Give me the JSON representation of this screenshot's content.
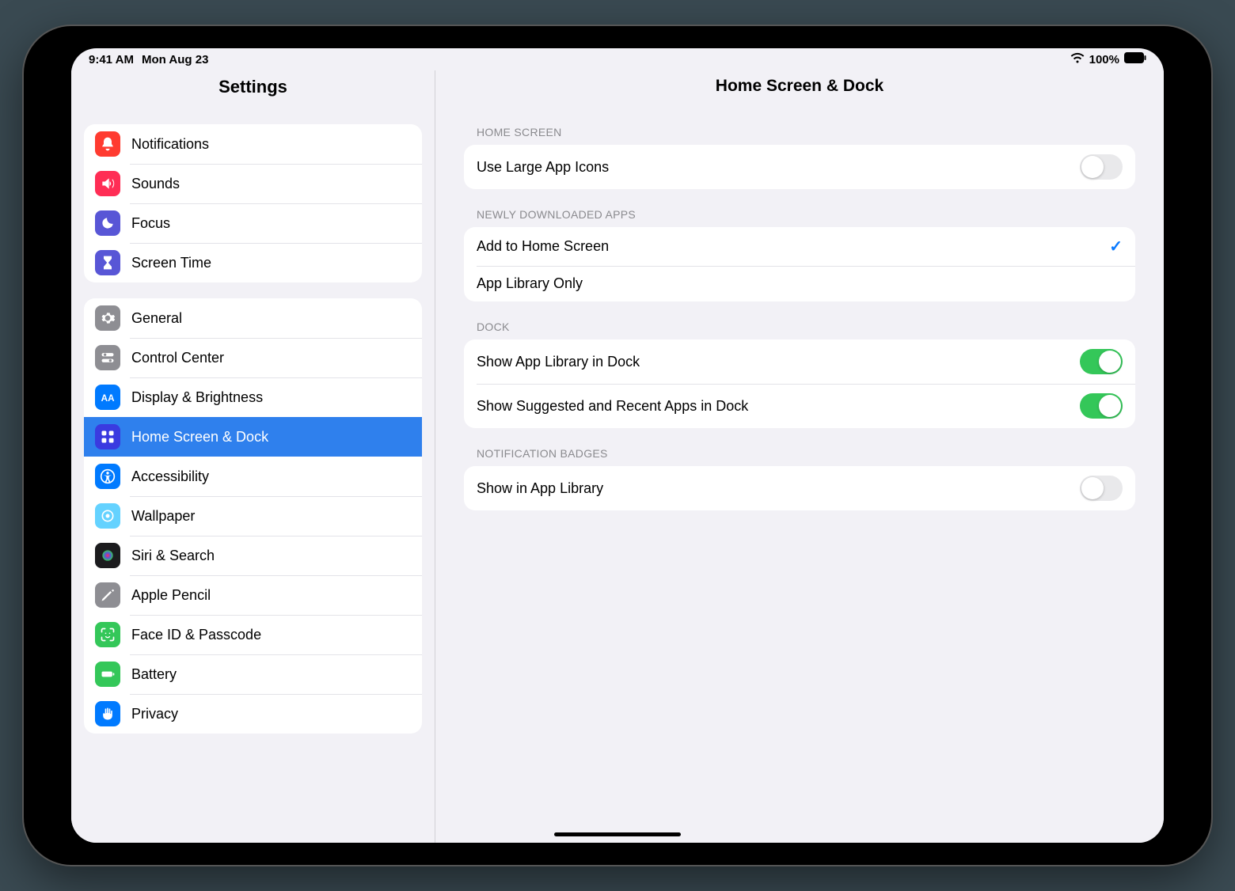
{
  "status": {
    "time": "9:41 AM",
    "date": "Mon Aug 23",
    "battery_pct": "100%"
  },
  "sidebar": {
    "title": "Settings",
    "group1": [
      {
        "label": "Notifications",
        "icon": "bell-icon"
      },
      {
        "label": "Sounds",
        "icon": "speaker-icon"
      },
      {
        "label": "Focus",
        "icon": "moon-icon"
      },
      {
        "label": "Screen Time",
        "icon": "hourglass-icon"
      }
    ],
    "group2": [
      {
        "label": "General",
        "icon": "gear-icon"
      },
      {
        "label": "Control Center",
        "icon": "switches-icon"
      },
      {
        "label": "Display & Brightness",
        "icon": "text-size-icon"
      },
      {
        "label": "Home Screen & Dock",
        "icon": "grid-icon",
        "selected": true
      },
      {
        "label": "Accessibility",
        "icon": "accessibility-icon"
      },
      {
        "label": "Wallpaper",
        "icon": "wallpaper-icon"
      },
      {
        "label": "Siri & Search",
        "icon": "siri-icon"
      },
      {
        "label": "Apple Pencil",
        "icon": "pencil-icon"
      },
      {
        "label": "Face ID & Passcode",
        "icon": "faceid-icon"
      },
      {
        "label": "Battery",
        "icon": "battery-icon"
      },
      {
        "label": "Privacy",
        "icon": "hand-icon"
      }
    ]
  },
  "detail": {
    "title": "Home Screen & Dock",
    "sections": {
      "home_screen": {
        "header": "HOME SCREEN",
        "rows": [
          {
            "label": "Use Large App Icons",
            "type": "toggle",
            "on": false
          }
        ]
      },
      "newly": {
        "header": "NEWLY DOWNLOADED APPS",
        "rows": [
          {
            "label": "Add to Home Screen",
            "type": "check",
            "checked": true
          },
          {
            "label": "App Library Only",
            "type": "check",
            "checked": false
          }
        ]
      },
      "dock": {
        "header": "DOCK",
        "rows": [
          {
            "label": "Show App Library in Dock",
            "type": "toggle",
            "on": true
          },
          {
            "label": "Show Suggested and Recent Apps in Dock",
            "type": "toggle",
            "on": true
          }
        ]
      },
      "badges": {
        "header": "NOTIFICATION BADGES",
        "rows": [
          {
            "label": "Show in App Library",
            "type": "toggle",
            "on": false
          }
        ]
      }
    }
  }
}
